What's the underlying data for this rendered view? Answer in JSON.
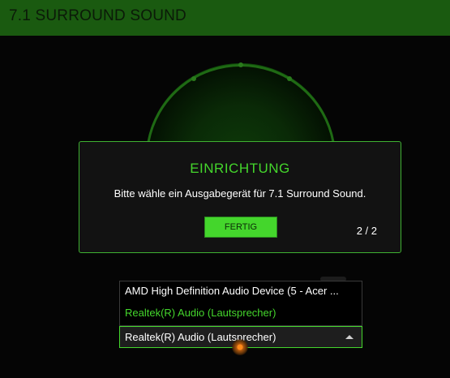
{
  "window": {
    "title": "7.1 SURROUND SOUND"
  },
  "modal": {
    "heading": "EINRICHTUNG",
    "message": "Bitte wähle ein Ausgabegerät für 7.1 Surround Sound.",
    "done_label": "FERTIG",
    "pager": "2 / 2"
  },
  "device_select": {
    "options": [
      "AMD High Definition Audio Device (5 - Acer ...",
      "Realtek(R) Audio (Lautsprecher)"
    ],
    "selected": "Realtek(R) Audio (Lautsprecher)"
  },
  "colors": {
    "accent": "#44d62c",
    "titlebar": "#1a5a10",
    "background": "#050505",
    "modal_bg": "#121212",
    "handle": "#ff8a1a"
  },
  "icons": {
    "caret": "caret-up-icon",
    "handle": "orange-knob-icon"
  }
}
